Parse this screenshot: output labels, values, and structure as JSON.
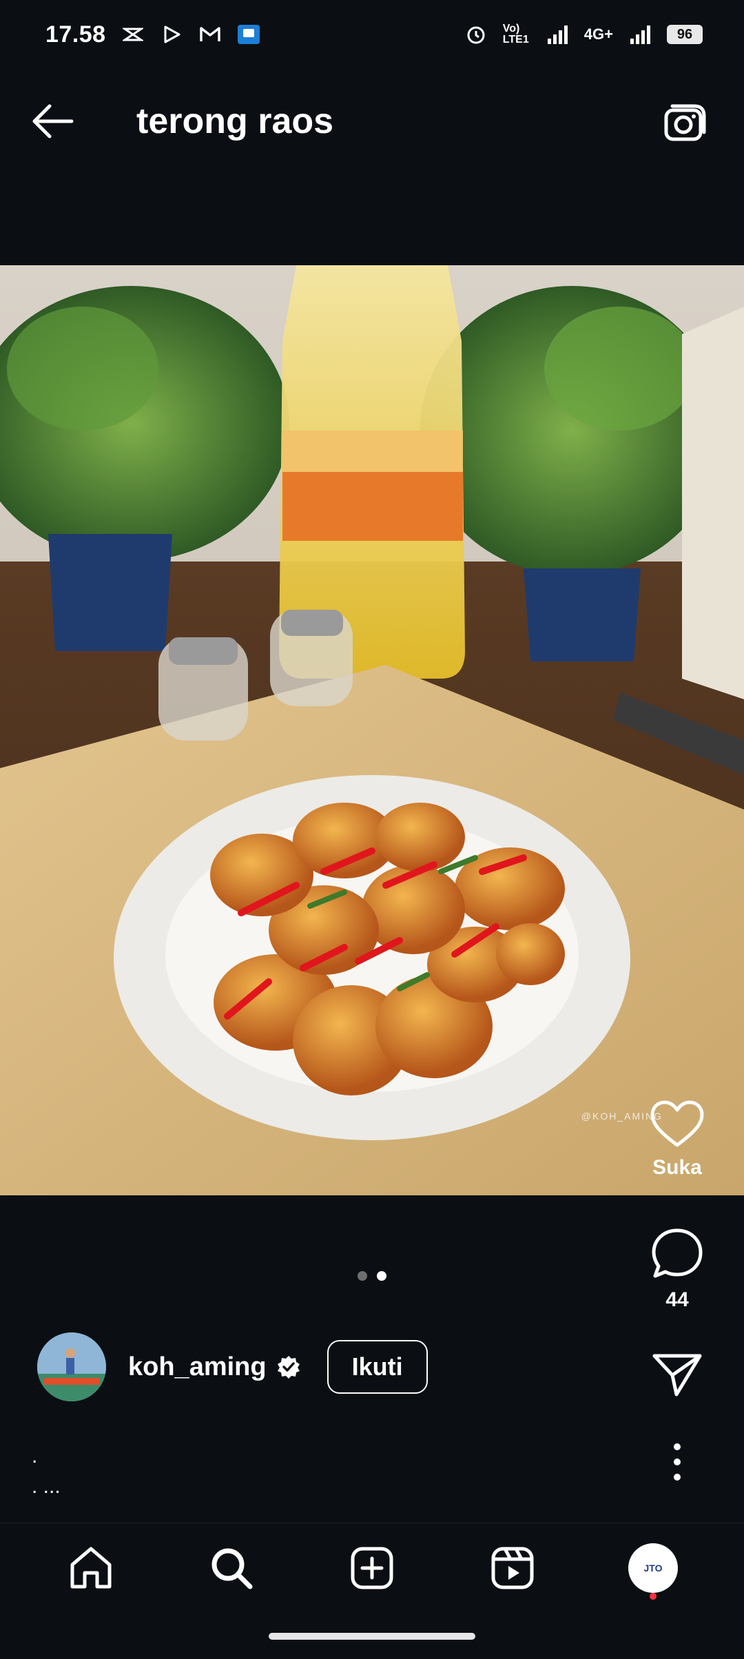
{
  "status_bar": {
    "time": "17.58",
    "network_label": "4G+",
    "volte_label": "Vo) LTE1",
    "battery": "96"
  },
  "header": {
    "title": "terong raos"
  },
  "post": {
    "watermark": "@KOH_AMING",
    "like_label": "Suka",
    "comment_count": "44",
    "page_count": 2,
    "active_page": 2
  },
  "author": {
    "username": "koh_aming",
    "follow_label": "Ikuti"
  },
  "caption": {
    "line1": ".",
    "line2": ". ..."
  },
  "nav": {
    "profile_text": "JTO"
  }
}
